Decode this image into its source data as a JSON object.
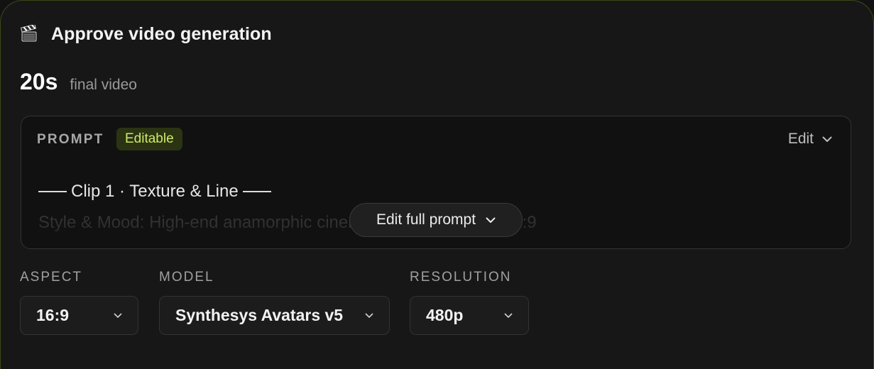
{
  "header": {
    "icon": "clapperboard-icon",
    "title": "Approve video generation"
  },
  "duration": {
    "value": "20s",
    "label": "final video"
  },
  "prompt": {
    "label": "PROMPT",
    "badge": "Editable",
    "edit_label": "Edit",
    "clip_title": "Clip 1 · Texture & Line",
    "style_preview": "Style & Mood: High-end anamorphic cinematic commercial in 16:9",
    "full_prompt_button": "Edit full prompt"
  },
  "settings": {
    "aspect": {
      "label": "ASPECT",
      "value": "16:9"
    },
    "model": {
      "label": "MODEL",
      "value": "Synthesys Avatars v5"
    },
    "resolution": {
      "label": "RESOLUTION",
      "value": "480p"
    }
  },
  "colors": {
    "accent": "#cfe86a",
    "badge_bg": "#2a3412",
    "card_border": "#3a4a16"
  }
}
